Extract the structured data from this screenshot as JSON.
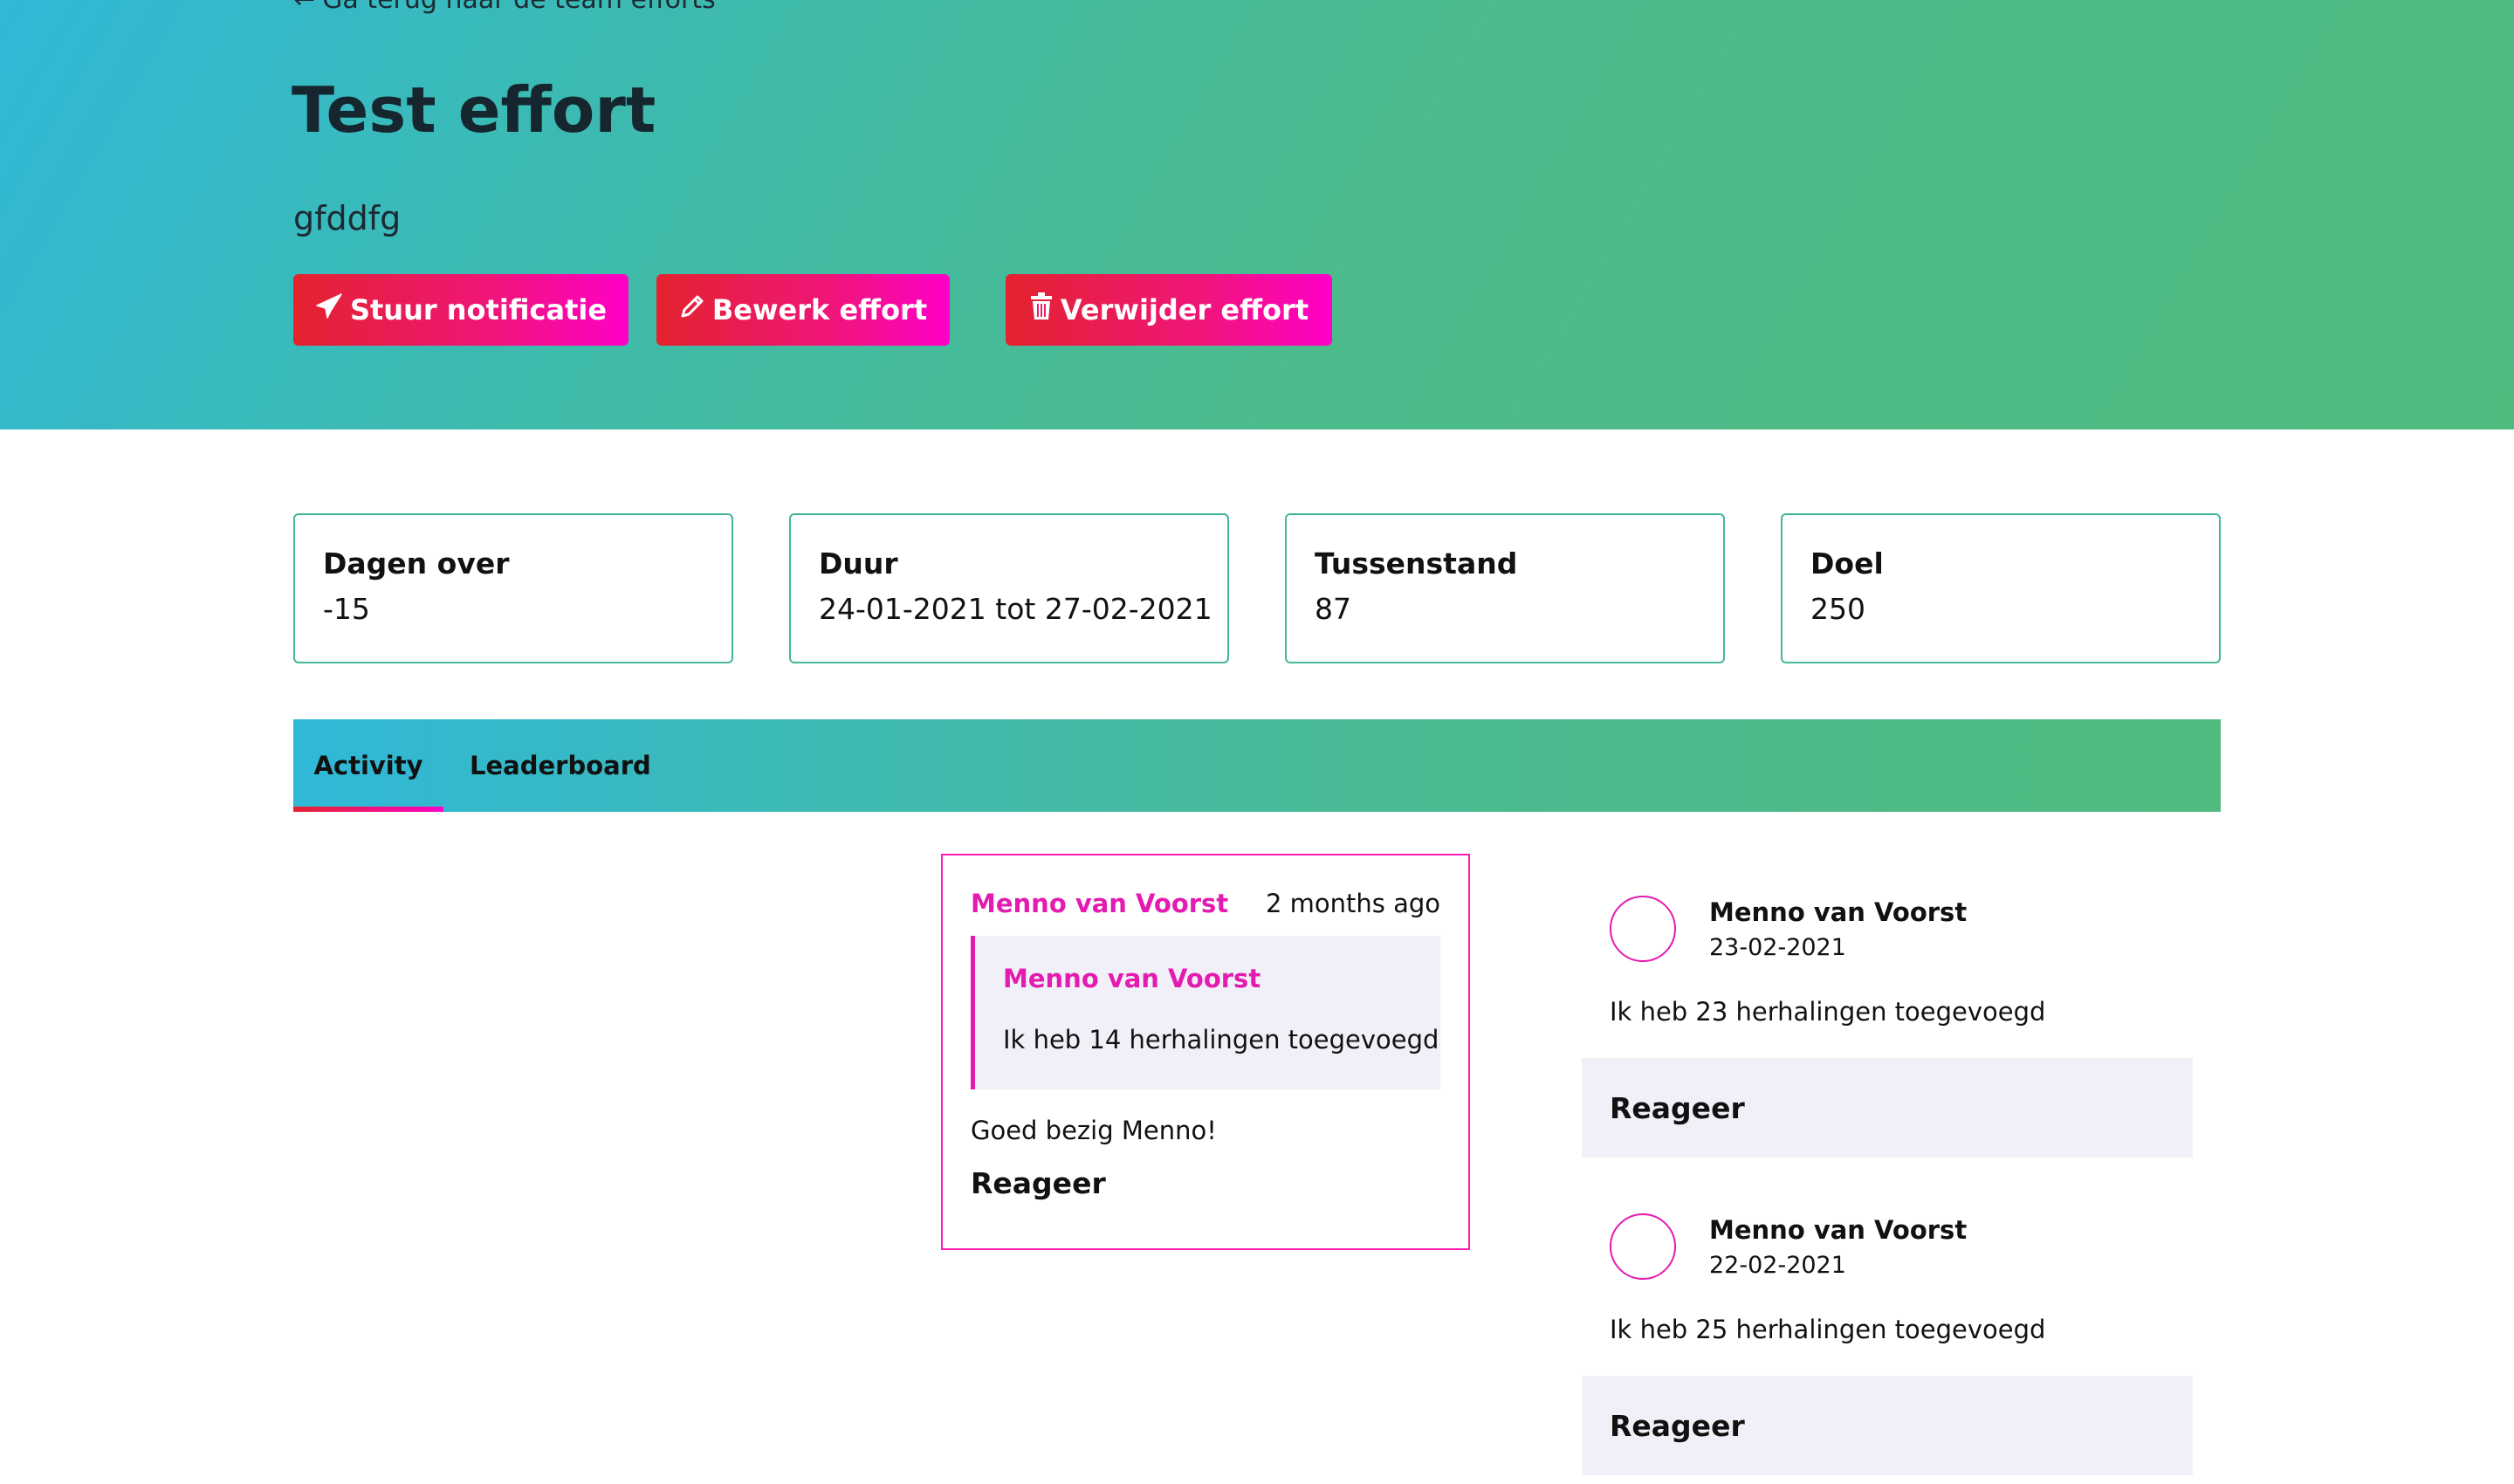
{
  "header": {
    "back_link": "Ga terug naar de team efforts",
    "title": "Test effort",
    "subtitle": "gfddfg"
  },
  "actions": {
    "notify_label": "Stuur notificatie",
    "edit_label": "Bewerk effort",
    "delete_label": "Verwijder effort"
  },
  "stats": [
    {
      "label": "Dagen over",
      "value": "-15"
    },
    {
      "label": "Duur",
      "value": "24-01-2021 tot 27-02-2021"
    },
    {
      "label": "Tussenstand",
      "value": "87"
    },
    {
      "label": "Doel",
      "value": "250"
    }
  ],
  "tabs": [
    {
      "label": "Activity",
      "active": true
    },
    {
      "label": "Leaderboard",
      "active": false
    }
  ],
  "highlighted_comment": {
    "author": "Menno van Voorst",
    "time": "2 months ago",
    "quote_author": "Menno van Voorst",
    "quote_text": "Ik heb 14 herhalingen toegevoegd",
    "message": "Goed bezig Menno!",
    "reply_label": "Reageer"
  },
  "feed": [
    {
      "name": "Menno van Voorst",
      "date": "23-02-2021",
      "text": "Ik heb 23 herhalingen toegevoegd",
      "reply_label": "Reageer"
    },
    {
      "name": "Menno van Voorst",
      "date": "22-02-2021",
      "text": "Ik heb 25 herhalingen toegevoegd",
      "reply_label": "Reageer"
    }
  ],
  "colors": {
    "accent_pink": "#e41bb0",
    "accent_red": "#e3232e",
    "gradient_start": "#2fb8d8",
    "gradient_end": "#50bb7f",
    "card_border": "#44b79a",
    "reply_bg": "#f1f0f8"
  },
  "icons": {
    "back": "arrow-left-icon",
    "notify": "paper-plane-icon",
    "edit": "pencil-icon",
    "delete": "trash-icon"
  }
}
